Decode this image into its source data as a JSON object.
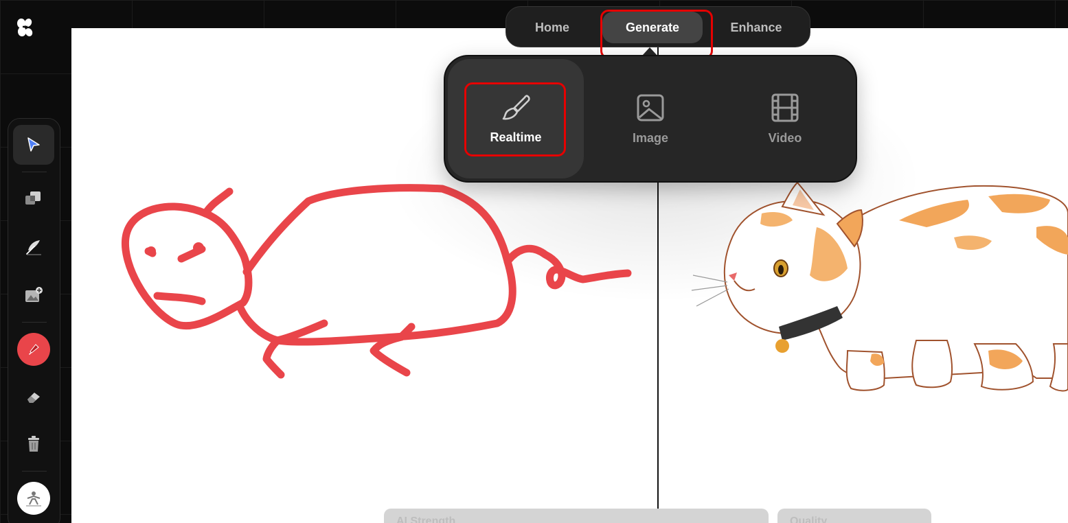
{
  "app": {
    "logo": "logo-icon"
  },
  "nav": {
    "tabs": [
      {
        "label": "Home",
        "active": false
      },
      {
        "label": "Generate",
        "active": true
      },
      {
        "label": "Enhance",
        "active": false
      }
    ]
  },
  "generate_menu": {
    "items": [
      {
        "label": "Realtime",
        "icon": "paintbrush-icon",
        "active": true
      },
      {
        "label": "Image",
        "icon": "image-icon",
        "active": false
      },
      {
        "label": "Video",
        "icon": "film-icon",
        "active": false
      }
    ]
  },
  "toolbar": {
    "tools": [
      {
        "name": "select-tool",
        "icon": "cursor-arrow-icon",
        "selected": true
      },
      {
        "name": "layers-tool",
        "icon": "layers-icon"
      },
      {
        "name": "feather-tool",
        "icon": "feather-icon"
      },
      {
        "name": "add-image-tool",
        "icon": "image-add-icon"
      },
      {
        "name": "brush-tool",
        "icon": "brush-icon",
        "color": "#e9454a"
      },
      {
        "name": "eraser-tool",
        "icon": "eraser-icon"
      },
      {
        "name": "delete-tool",
        "icon": "trash-icon"
      },
      {
        "name": "background-tool",
        "icon": "scene-icon"
      }
    ]
  },
  "bottom_controls": {
    "ai_strength_label": "AI Strength",
    "quality_label": "Quality"
  },
  "colors": {
    "accent": "#e9454a",
    "highlight": "#e60000",
    "panel": "#262626"
  }
}
